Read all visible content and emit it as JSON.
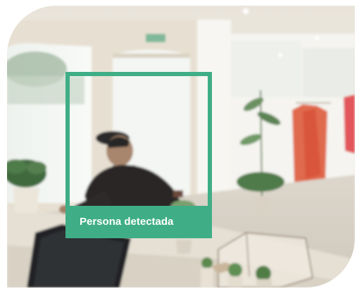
{
  "detection": {
    "label": "Persona detectada",
    "color": "#3fae86"
  }
}
